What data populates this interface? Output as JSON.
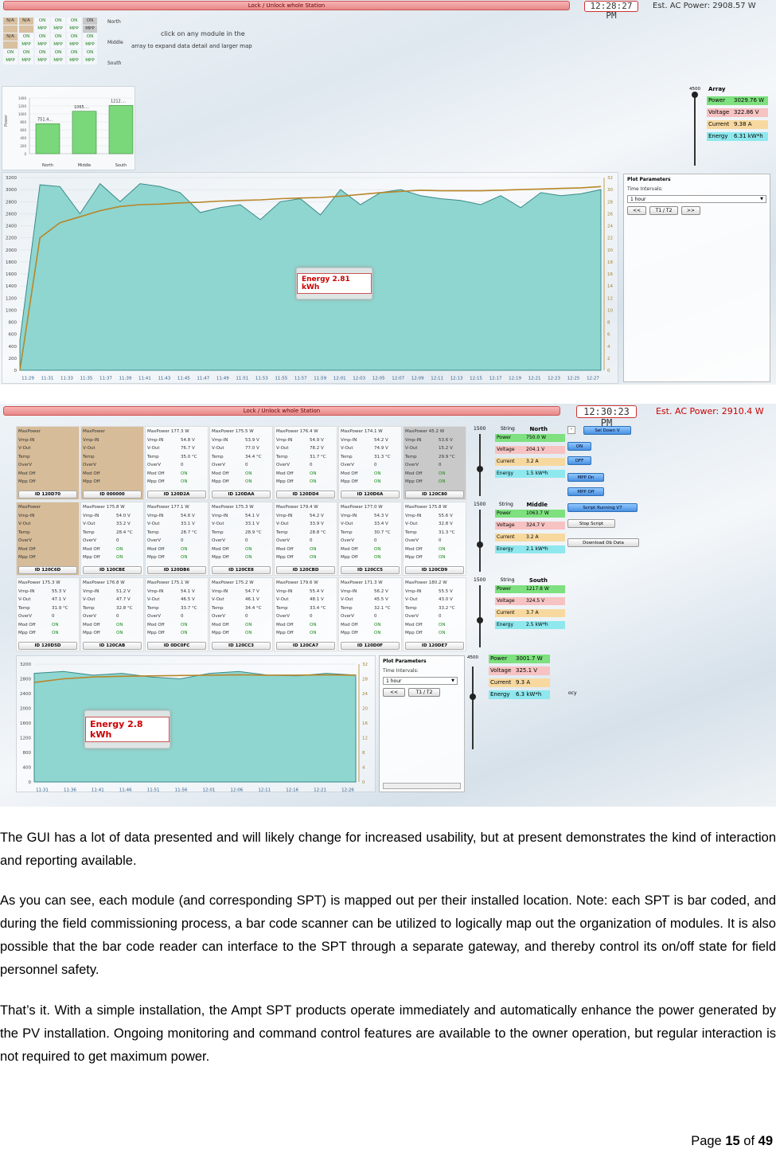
{
  "shot1": {
    "lock_label": "Lock / Unlock whole Station",
    "clock": "12:28:27 PM",
    "ac_power": "Est. AC Power: 2908.57 W",
    "grid_rows": [
      [
        "N/A",
        "N/A",
        "ON",
        "ON",
        "ON",
        "ON"
      ],
      [
        "",
        "",
        "MPP",
        "MPP",
        "MPP",
        "MPP"
      ],
      [
        "N/A",
        "ON",
        "ON",
        "ON",
        "ON",
        "ON"
      ],
      [
        "",
        "MPP",
        "MPP",
        "MPP",
        "MPP",
        "MPP"
      ],
      [
        "ON",
        "ON",
        "ON",
        "ON",
        "ON",
        "ON"
      ],
      [
        "MPP",
        "MPP",
        "MPP",
        "MPP",
        "MPP",
        "MPP"
      ]
    ],
    "row_labels": [
      "North",
      "Middle",
      "South"
    ],
    "hint_line1": "click on any module in the",
    "hint_line2": "array to expand data detail and larger map",
    "bar_chart": {
      "ylabel": "Power",
      "yticks": [
        "1400",
        "1200",
        "1000",
        "800",
        "600",
        "400",
        "200",
        "0"
      ],
      "categories": [
        "North",
        "Middle",
        "South"
      ],
      "values": [
        751.4,
        1065,
        1212
      ],
      "labels": [
        "751.4...",
        "1065....",
        "1212...."
      ]
    },
    "array_title": "Array",
    "slider_top": "4500",
    "metrics": [
      {
        "k": "Power",
        "v": "3029.76 W",
        "c": "#7ee07e"
      },
      {
        "k": "Voltage",
        "v": "322.86 V",
        "c": "#f7c2c2"
      },
      {
        "k": "Current",
        "v": "9.38 A",
        "c": "#f7d9a0"
      },
      {
        "k": "Energy",
        "v": "6.31 kW*h",
        "c": "#8ee8ee"
      }
    ],
    "plot_params": {
      "title": "Plot Parameters",
      "time_intervals": "Time Intervals:",
      "selected": "1 hour",
      "b1": "<<",
      "b2": "T1 / T2",
      "b3": ">>"
    },
    "energy_label": "Energy 2.81 kWh",
    "yleft": [
      "3200",
      "3000",
      "2800",
      "2600",
      "2400",
      "2200",
      "2000",
      "1800",
      "1600",
      "1400",
      "1200",
      "1000",
      "800",
      "600",
      "400",
      "200",
      "0"
    ],
    "yright": [
      "32",
      "30",
      "28",
      "26",
      "24",
      "22",
      "20",
      "18",
      "16",
      "14",
      "12",
      "10",
      "8",
      "6",
      "4",
      "2",
      "0"
    ],
    "xticks": [
      "11:29",
      "11:31",
      "11:33",
      "11:35",
      "11:37",
      "11:39",
      "11:41",
      "11:43",
      "11:45",
      "11:47",
      "11:49",
      "11:51",
      "11:53",
      "11:55",
      "11:57",
      "11:59",
      "12:01",
      "12:03",
      "12:05",
      "12:07",
      "12:09",
      "12:11",
      "12:13",
      "12:15",
      "12:17",
      "12:19",
      "12:21",
      "12:23",
      "12:25",
      "12:27"
    ]
  },
  "shot2": {
    "lock_label": "Lock / Unlock whole Station",
    "clock": "12:30:23 PM",
    "ac_power": "Est. AC Power: 2910.4 W",
    "modules": [
      {
        "style": "tan",
        "p": "MaxPower",
        "id": "120D70",
        "v": [
          "Vmp-IN",
          "V-Out",
          "Temp",
          "OverV",
          "Mod Off",
          "Mpp Off"
        ],
        "w": [
          "",
          "",
          "",
          "",
          "",
          ""
        ]
      },
      {
        "style": "tan",
        "p": "MaxPower",
        "id": "000000",
        "v": [
          "Vmp-IN",
          "V-Out",
          "Temp",
          "OverV",
          "Mod Off",
          "Mpp Off"
        ],
        "w": [
          "",
          "",
          "",
          "",
          "",
          ""
        ]
      },
      {
        "style": "",
        "p": "MaxPower 177.3 W",
        "id": "120D2A",
        "v": [
          "Vmp-IN",
          "V-Out",
          "Temp",
          "OverV",
          "Mod Off",
          "Mpp Off"
        ],
        "w": [
          "54.8 V",
          "76.7 V",
          "35.0 °C",
          "0",
          "ON",
          "ON"
        ]
      },
      {
        "style": "",
        "p": "MaxPower 175.5 W",
        "id": "120DAA",
        "v": [
          "Vmp-IN",
          "V-Out",
          "Temp",
          "OverV",
          "Mod Off",
          "Mpp Off"
        ],
        "w": [
          "53.9 V",
          "77.0 V",
          "34.4 °C",
          "0",
          "ON",
          "ON"
        ]
      },
      {
        "style": "",
        "p": "MaxPower 176.4 W",
        "id": "120DD4",
        "v": [
          "Vmp-IN",
          "V-Out",
          "Temp",
          "OverV",
          "Mod Off",
          "Mpp Off"
        ],
        "w": [
          "54.9 V",
          "78.2 V",
          "31.7 °C",
          "0",
          "ON",
          "ON"
        ]
      },
      {
        "style": "",
        "p": "MaxPower 174.1 W",
        "id": "120D6A",
        "v": [
          "Vmp-IN",
          "V-Out",
          "Temp",
          "OverV",
          "Mod Off",
          "Mpp Off"
        ],
        "w": [
          "54.2 V",
          "74.9 V",
          "31.3 °C",
          "0",
          "ON",
          "ON"
        ]
      },
      {
        "style": "gray",
        "p": "MaxPower 45.2 W",
        "id": "120C80",
        "v": [
          "Vmp-IN",
          "V-Out",
          "Temp",
          "OverV",
          "Mod Off",
          "Mpp Off"
        ],
        "w": [
          "53.6 V",
          "15.2 V",
          "29.9 °C",
          "0",
          "ON",
          "ON"
        ]
      },
      {
        "style": "tan",
        "p": "MaxPower",
        "id": "120C6D",
        "v": [
          "Vmp-IN",
          "V-Out",
          "Temp",
          "OverV",
          "Mod Off",
          "Mpp Off"
        ],
        "w": [
          "",
          "",
          "",
          "",
          "",
          ""
        ]
      },
      {
        "style": "",
        "p": "MaxPower 175.8 W",
        "id": "120CBE",
        "v": [
          "Vmp-IN",
          "V-Out",
          "Temp",
          "OverV",
          "Mod Off",
          "Mpp Off"
        ],
        "w": [
          "54.0 V",
          "33.2 V",
          "28.4 °C",
          "0",
          "ON",
          "ON"
        ]
      },
      {
        "style": "",
        "p": "MaxPower 177.1 W",
        "id": "120DB6",
        "v": [
          "Vmp-IN",
          "V-Out",
          "Temp",
          "OverV",
          "Mod Off",
          "Mpp Off"
        ],
        "w": [
          "54.6 V",
          "33.1 V",
          "28.7 °C",
          "0",
          "ON",
          "ON"
        ]
      },
      {
        "style": "",
        "p": "MaxPower 175.3 W",
        "id": "120CE8",
        "v": [
          "Vmp-IN",
          "V-Out",
          "Temp",
          "OverV",
          "Mod Off",
          "Mpp Off"
        ],
        "w": [
          "54.1 V",
          "33.1 V",
          "28.9 °C",
          "0",
          "ON",
          "ON"
        ]
      },
      {
        "style": "",
        "p": "MaxPower 179.4 W",
        "id": "120CBD",
        "v": [
          "Vmp-IN",
          "V-Out",
          "Temp",
          "OverV",
          "Mod Off",
          "Mpp Off"
        ],
        "w": [
          "54.2 V",
          "33.9 V",
          "28.8 °C",
          "0",
          "ON",
          "ON"
        ]
      },
      {
        "style": "",
        "p": "MaxPower 177.0 W",
        "id": "120CC5",
        "v": [
          "Vmp-IN",
          "V-Out",
          "Temp",
          "OverV",
          "Mod Off",
          "Mpp Off"
        ],
        "w": [
          "54.3 V",
          "33.4 V",
          "30.7 °C",
          "0",
          "ON",
          "ON"
        ]
      },
      {
        "style": "",
        "p": "MaxPower 175.8 W",
        "id": "120CD9",
        "v": [
          "Vmp-IN",
          "V-Out",
          "Temp",
          "OverV",
          "Mod Off",
          "Mpp Off"
        ],
        "w": [
          "55.6 V",
          "32.8 V",
          "31.3 °C",
          "0",
          "ON",
          "ON"
        ]
      },
      {
        "style": "",
        "p": "MaxPower 175.3 W",
        "id": "120D5D",
        "v": [
          "Vmp-IN",
          "V-Out",
          "Temp",
          "OverV",
          "Mod Off",
          "Mpp Off"
        ],
        "w": [
          "55.3 V",
          "47.1 V",
          "31.9 °C",
          "0",
          "ON",
          "ON"
        ]
      },
      {
        "style": "",
        "p": "MaxPower 176.8 W",
        "id": "120CAB",
        "v": [
          "Vmp-IN",
          "V-Out",
          "Temp",
          "OverV",
          "Mod Off",
          "Mpp Off"
        ],
        "w": [
          "51.2 V",
          "47.7 V",
          "32.8 °C",
          "0",
          "ON",
          "ON"
        ]
      },
      {
        "style": "",
        "p": "MaxPower 175.1 W",
        "id": "0DC0FC",
        "v": [
          "Vmp-IN",
          "V-Out",
          "Temp",
          "OverV",
          "Mod Off",
          "Mpp Off"
        ],
        "w": [
          "54.1 V",
          "46.5 V",
          "33.7 °C",
          "0",
          "ON",
          "ON"
        ]
      },
      {
        "style": "",
        "p": "MaxPower 175.2 W",
        "id": "120CC3",
        "v": [
          "Vmp-IN",
          "V-Out",
          "Temp",
          "OverV",
          "Mod Off",
          "Mpp Off"
        ],
        "w": [
          "54.7 V",
          "46.1 V",
          "34.4 °C",
          "0",
          "ON",
          "ON"
        ]
      },
      {
        "style": "",
        "p": "MaxPower 179.6 W",
        "id": "120CA7",
        "v": [
          "Vmp-IN",
          "V-Out",
          "Temp",
          "OverV",
          "Mod Off",
          "Mpp Off"
        ],
        "w": [
          "55.4 V",
          "48.1 V",
          "33.4 °C",
          "0",
          "ON",
          "ON"
        ]
      },
      {
        "style": "",
        "p": "MaxPower 171.3 W",
        "id": "120D0F",
        "v": [
          "Vmp-IN",
          "V-Out",
          "Temp",
          "OverV",
          "Mod Off",
          "Mpp Off"
        ],
        "w": [
          "56.2 V",
          "45.5 V",
          "32.1 °C",
          "0",
          "ON",
          "ON"
        ]
      },
      {
        "style": "",
        "p": "MaxPower 180.2 W",
        "id": "120DE7",
        "v": [
          "Vmp-IN",
          "V-Out",
          "Temp",
          "OverV",
          "Mod Off",
          "Mpp Off"
        ],
        "w": [
          "55.5 V",
          "43.0 V",
          "33.2 °C",
          "0",
          "ON",
          "ON"
        ]
      }
    ],
    "strings": [
      {
        "name": "North",
        "label": "String",
        "max": "1500",
        "m": [
          {
            "k": "Power",
            "v": "750.0 W",
            "c": "#7ee07e"
          },
          {
            "k": "Voltage",
            "v": "204.1 V",
            "c": "#f7c2c2"
          },
          {
            "k": "Current",
            "v": "3.2 A",
            "c": "#f7d9a0"
          },
          {
            "k": "Energy",
            "v": "1.5 kW*h",
            "c": "#8ee8ee"
          }
        ]
      },
      {
        "name": "Middle",
        "label": "String",
        "max": "1500",
        "m": [
          {
            "k": "Power",
            "v": "1063.7 W",
            "c": "#7ee07e"
          },
          {
            "k": "Voltage",
            "v": "324.7 V",
            "c": "#f7c2c2"
          },
          {
            "k": "Current",
            "v": "3.2 A",
            "c": "#f7d9a0"
          },
          {
            "k": "Energy",
            "v": "2.1 kW*h",
            "c": "#8ee8ee"
          }
        ]
      },
      {
        "name": "South",
        "label": "String",
        "max": "1500",
        "m": [
          {
            "k": "Power",
            "v": "1217.8 W",
            "c": "#7ee07e"
          },
          {
            "k": "Voltage",
            "v": "324.5 V",
            "c": "#f7c2c2"
          },
          {
            "k": "Current",
            "v": "3.7 A",
            "c": "#f7d9a0"
          },
          {
            "k": "Energy",
            "v": "2.5 kW*h",
            "c": "#8ee8ee"
          }
        ]
      }
    ],
    "buttons": {
      "sel_down": "Sel Down V",
      "on": "ON",
      "off": "OFF",
      "mpp_on": "MPP On",
      "mpp_off": "MPP Off",
      "script_running": "Script Running V7",
      "stop_script": "Stop Script",
      "download": "Download Db Data"
    },
    "plot_params": {
      "title": "Plot Parameters",
      "time_intervals": "Time Intervals:",
      "selected": "1 hour",
      "b1": "<<",
      "b2": "T1 / T2"
    },
    "energy_label": "Energy 2.8 kWh",
    "yleft": [
      "3200",
      "2800",
      "2400",
      "2000",
      "1600",
      "1200",
      "800",
      "400",
      "0"
    ],
    "yright": [
      "32",
      "28",
      "24",
      "20",
      "16",
      "12",
      "8",
      "4",
      "0"
    ],
    "xticks": [
      "11:31",
      "11:36",
      "11:41",
      "11:46",
      "11:51",
      "11:56",
      "12:01",
      "12:06",
      "12:11",
      "12:16",
      "12:21",
      "12:26"
    ],
    "array_slider_max": "4500",
    "array_metrics": [
      {
        "k": "Power",
        "v": "3001.7 W",
        "c": "#7ee07e"
      },
      {
        "k": "Voltage",
        "v": "325.1 V",
        "c": "#f7c2c2"
      },
      {
        "k": "Current",
        "v": "9.3 A",
        "c": "#f7d9a0"
      },
      {
        "k": "Energy",
        "v": "6.3 kW*h",
        "c": "#8ee8ee"
      }
    ],
    "array_energy_extra": "ocy"
  },
  "paragraphs": [
    "The GUI has a lot of data presented and will likely change for increased usability, but at present demonstrates the kind of interaction and reporting available.",
    "As you can see, each module (and corresponding SPT) is mapped out per their installed location. Note: each SPT is bar coded, and during the field commissioning process, a bar code scanner can be utilized to logically map out the organization of modules. It is also possible that the bar code reader can interface to the SPT through a separate gateway, and thereby control its on/off state for field personnel safety.",
    "That’s it. With a simple installation, the Ampt SPT products operate immediately and automatically enhance the power generated by the PV installation. Ongoing monitoring and command control features are available to the owner operation, but regular interaction is not required to get maximum power."
  ],
  "footer": {
    "page_word": "Page",
    "page": "15",
    "of_word": "of",
    "total": "49"
  },
  "chart_data": [
    {
      "type": "bar",
      "categories": [
        "North",
        "Middle",
        "South"
      ],
      "values": [
        751.4,
        1065,
        1212
      ],
      "ylabel": "Power",
      "ylim": [
        0,
        1400
      ]
    },
    {
      "type": "area",
      "xlabel": "",
      "x": [
        "11:29",
        "11:31",
        "11:33",
        "11:35",
        "11:37",
        "11:39",
        "11:41",
        "11:43",
        "11:45",
        "11:47",
        "11:49",
        "11:51",
        "11:53",
        "11:55",
        "11:57",
        "11:59",
        "12:01",
        "12:03",
        "12:05",
        "12:07",
        "12:09",
        "12:11",
        "12:13",
        "12:15",
        "12:17",
        "12:19",
        "12:21",
        "12:23",
        "12:25",
        "12:27"
      ],
      "series": [
        {
          "values": [
            500,
            3080,
            3050,
            2600,
            3100,
            2800,
            3100,
            3050,
            2950,
            2620,
            2700,
            2750,
            2500,
            2800,
            2850,
            2580,
            3000,
            2750,
            2950,
            3000,
            2900,
            2850,
            2820,
            2750,
            2900,
            2700,
            2950,
            2900,
            2930,
            3000
          ]
        },
        {
          "values": [
            0,
            2200,
            2450,
            2550,
            2650,
            2720,
            2750,
            2760,
            2780,
            2790,
            2810,
            2820,
            2830,
            2850,
            2860,
            2870,
            2890,
            2920,
            2950,
            2970,
            2990,
            2980,
            2980,
            2980,
            2990,
            3000,
            3010,
            3020,
            3030,
            3050
          ]
        }
      ],
      "ylim": [
        0,
        3200
      ]
    },
    {
      "type": "area",
      "x": [
        "11:31",
        "11:36",
        "11:41",
        "11:46",
        "11:51",
        "11:56",
        "12:01",
        "12:06",
        "12:11",
        "12:16",
        "12:21",
        "12:26"
      ],
      "series": [
        {
          "values": [
            2950,
            3000,
            2900,
            2950,
            2850,
            2800,
            2950,
            3000,
            2900,
            2880,
            2950,
            2900
          ]
        },
        {
          "values": [
            2700,
            2800,
            2850,
            2870,
            2880,
            2890,
            2900,
            2910,
            2900,
            2900,
            2905,
            2900
          ]
        }
      ],
      "ylim": [
        0,
        3200
      ]
    }
  ]
}
